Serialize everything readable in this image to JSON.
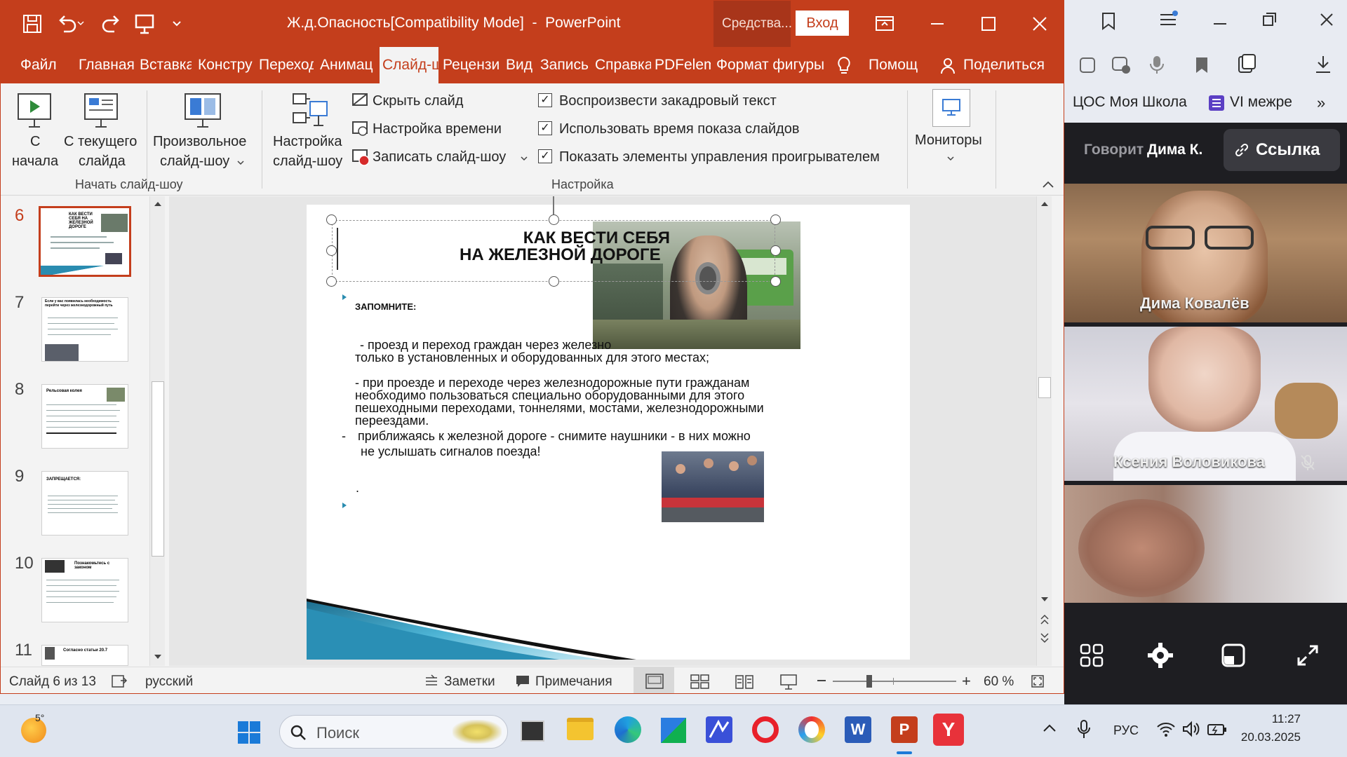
{
  "window": {
    "title": "Ж.д.Опасность[Compatibility Mode]  -  PowerPoint",
    "context_tab": "Средства...",
    "signin": "Вход"
  },
  "tabs": [
    "Файл",
    "Главная",
    "Вставка",
    "Констру",
    "Переход",
    "Анимац",
    "Слайд-ш",
    "Рецензи",
    "Вид",
    "Запись",
    "Справка",
    "PDFelem",
    "Формат фигуры",
    "Помощ",
    "Поделиться"
  ],
  "active_tab": "Слайд-ш",
  "ribbon": {
    "start_group": "Начать слайд-шоу",
    "setup_group": "Настройка",
    "from_start_line1": "С",
    "from_start_line2": "начала",
    "from_current_line1": "С текущего",
    "from_current_line2": "слайда",
    "custom_line1": "Произвольное",
    "custom_line2": "слайд-шоу",
    "setup_line1": "Настройка",
    "setup_line2": "слайд-шоу",
    "hide_slide": "Скрыть слайд",
    "rehearse": "Настройка времени",
    "record": "Записать слайд-шоу",
    "play_narrations": "Воспроизвести закадровый текст",
    "use_timings": "Использовать время показа слайдов",
    "show_media": "Показать элементы управления проигрывателем",
    "monitors": "Мониторы"
  },
  "thumbnails": [
    {
      "num": "6",
      "text": "КАК ВЕСТИ СЕБЯ НА ЖЕЛЕЗНОЙ ДОРОГЕ"
    },
    {
      "num": "7",
      "text": "Если у вас появилась необходимость перейти через железнодорожный путь"
    },
    {
      "num": "8",
      "text": "Рельсовая колея"
    },
    {
      "num": "9",
      "text": "ЗАПРЕЩАЕТСЯ:"
    },
    {
      "num": "10",
      "text": "Познакомьтесь с законом"
    },
    {
      "num": "11",
      "text": "Согласно статьи 20.7"
    }
  ],
  "slide": {
    "title_line1": "КАК ВЕСТИ СЕБЯ",
    "title_line2": "НА ЖЕЛЕЗНОЙ ДОРОГЕ",
    "remember": "ЗАПОМНИТЕ:",
    "p1_line1": " - проезд и переход граждан через железно",
    "p1_line2": "только в установленных и оборудованных для этого местах;",
    "p2_line1": "- при проезде и переходе через железнодорожные пути гражданам",
    "p2_line2": "необходимо пользоваться специально оборудованными для этого",
    "p2_line3": "пешеходными переходами, тоннелями, мостами, железнодорожными",
    "p2_line4": "переездами.",
    "p3_dash": "-",
    "p3_line1": "приближаясь к железной дороге - снимите наушники - в них можно",
    "p3_line2": "не услышать сигналов поезда!",
    "dot": "."
  },
  "status": {
    "slide_counter": "Слайд 6 из 13",
    "language": "русский",
    "notes": "Заметки",
    "comments": "Примечания",
    "zoom": "60 %"
  },
  "browser": {
    "bookmark1": "ЦОС Моя Школа",
    "bookmark2": "VI межре"
  },
  "call": {
    "speaking_label": "Говорит",
    "speaking_name": "Дима К.",
    "link_button": "Ссылка",
    "participants": [
      "Дима Ковалёв",
      "Ксения Воловикова"
    ]
  },
  "taskbar": {
    "weather": "5°",
    "search_placeholder": "Поиск",
    "lang": "РУС",
    "time": "11:27",
    "date": "20.03.2025"
  },
  "colors": {
    "accent": "#c43e1c",
    "ribbon": "#f3f3f3",
    "call_bg": "#1e1e22"
  }
}
